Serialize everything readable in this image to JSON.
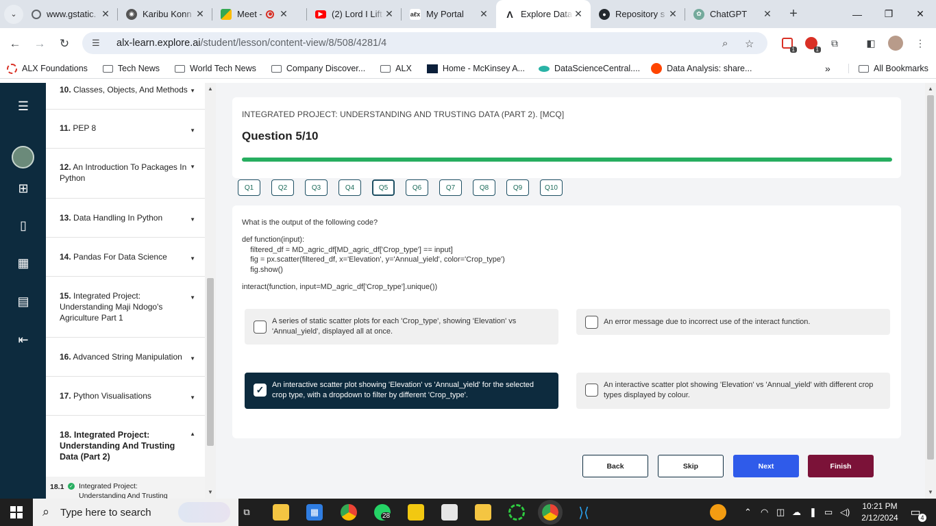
{
  "browser": {
    "tabs": [
      {
        "title": "www.gstatic.",
        "fav_color": "#5f6368",
        "recording": false
      },
      {
        "title": "Karibu Konn",
        "fav_color": "#6b6b6b",
        "recording": false
      },
      {
        "title": "Meet - q",
        "fav_color": "#34a853",
        "recording": true
      },
      {
        "title": "(2) Lord I Lift",
        "fav_color": "#ff0000",
        "recording": false
      },
      {
        "title": "My Portal",
        "fav_color": "#444444",
        "recording": false
      },
      {
        "title": "Explore Data",
        "fav_color": "#202124",
        "recording": false,
        "active": true
      },
      {
        "title": "Repository s",
        "fav_color": "#24292e",
        "recording": false
      },
      {
        "title": "ChatGPT",
        "fav_color": "#74aa9c",
        "recording": false
      }
    ],
    "url_main": "alx-learn.explore.ai",
    "url_path": "/student/lesson/content-view/8/508/4281/4",
    "bookmarks": [
      "ALX Foundations",
      "Tech News",
      "World Tech News",
      "Company Discover...",
      "ALX",
      "Home - McKinsey A...",
      "DataScienceCentral....",
      "Data Analysis: share..."
    ],
    "all_bookmarks": "All Bookmarks",
    "ext_badge_1": "1",
    "ext_badge_2": "1"
  },
  "sidebar": {
    "lessons": [
      {
        "num": "10.",
        "title": "Classes, Objects, And Methods",
        "expanded": false
      },
      {
        "num": "11.",
        "title": "PEP 8",
        "expanded": false
      },
      {
        "num": "12.",
        "title": "An Introduction To Packages In Python",
        "expanded": false
      },
      {
        "num": "13.",
        "title": "Data Handling In Python",
        "expanded": false
      },
      {
        "num": "14.",
        "title": "Pandas For Data Science",
        "expanded": false
      },
      {
        "num": "15.",
        "title": "Integrated Project: Understanding Maji Ndogo's Agriculture Part 1",
        "expanded": false
      },
      {
        "num": "16.",
        "title": "Advanced String Manipulation",
        "expanded": false
      },
      {
        "num": "17.",
        "title": "Python Visualisations",
        "expanded": false
      },
      {
        "num": "18.",
        "title": "Integrated Project: Understanding And Trusting Data (Part 2)",
        "expanded": true
      }
    ],
    "sub_item": {
      "num": "18.1",
      "title": "Integrated Project:",
      "title2": "Understanding And Trusting"
    }
  },
  "quiz": {
    "section_title": "INTEGRATED PROJECT: UNDERSTANDING AND TRUSTING DATA (PART 2). [MCQ]",
    "question_label": "Question 5/10",
    "progress_percent": 100,
    "question_nav": [
      "Q1",
      "Q2",
      "Q3",
      "Q4",
      "Q5",
      "Q6",
      "Q7",
      "Q8",
      "Q9",
      "Q10"
    ],
    "current_question": 5,
    "prompt": "What is the output of the following code?",
    "code_lines": [
      "def function(input):",
      "    filtered_df = MD_agric_df[MD_agric_df['Crop_type'] == input]",
      "    fig = px.scatter(filtered_df, x='Elevation', y='Annual_yield', color='Crop_type')",
      "    fig.show()",
      "interact(function, input=MD_agric_df['Crop_type'].unique())"
    ],
    "options": [
      {
        "text": "A series of static scatter plots for each 'Crop_type', showing 'Elevation' vs 'Annual_yield', displayed all at once.",
        "selected": false
      },
      {
        "text": "An error message due to incorrect use of the interact function.",
        "selected": false
      },
      {
        "text": "An interactive scatter plot showing 'Elevation' vs 'Annual_yield' for the selected crop type, with a dropdown to filter by different 'Crop_type'.",
        "selected": true
      },
      {
        "text": "An interactive scatter plot showing 'Elevation' vs 'Annual_yield' with different crop types displayed by colour.",
        "selected": false
      }
    ],
    "buttons": {
      "back": "Back",
      "skip": "Skip",
      "next": "Next",
      "finish": "Finish"
    }
  },
  "taskbar": {
    "search_placeholder": "Type here to search",
    "whatsapp_badge": "28",
    "time": "10:21 PM",
    "date": "2/12/2024",
    "notifications": "4"
  },
  "colors": {
    "navy": "#0d2b3e",
    "progress_green": "#27ae60",
    "next_blue": "#2f5bea",
    "finish_maroon": "#7b1238"
  }
}
